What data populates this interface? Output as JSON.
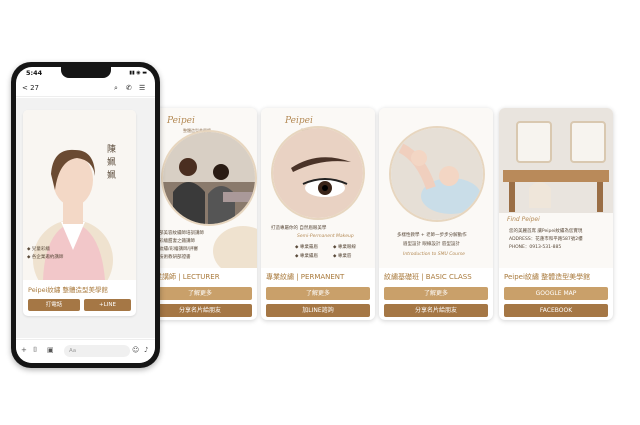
{
  "phone": {
    "time": "5:44",
    "status_icons": "▮▮ ◉ ▬",
    "chat_back": "< 27",
    "chat_icons": [
      "⌕",
      "✆",
      "☰"
    ],
    "profile_name_chars": [
      "陳",
      "姵",
      "姵"
    ],
    "bullets": [
      "兒童彩繪",
      "各企業邀約講師"
    ],
    "card_title": "Peipei紋繡 整體造型美學館",
    "btn_call": "打電話",
    "btn_line": "+LINE",
    "input_placeholder": "Aa",
    "input_icons": [
      "+",
      "⌷",
      "▣",
      "☺",
      "♪"
    ]
  },
  "cards": [
    {
      "brand": "Peipei",
      "brand_sub": "整體造型美學館",
      "captions": [
        "部美容紋繡師培訓講師",
        "彩繪甜妻之鐵講師",
        "紋繡/彩繪講師/評審",
        "技術教研部證書"
      ],
      "title": "專業講師 | LECTURER",
      "buttons": [
        "了解更多",
        "分享名片給朋友"
      ]
    },
    {
      "brand": "Peipei",
      "brand_sub": "整體造型美學館",
      "tagline": "打造專屬你的 自然眉眼美學",
      "script": "Semi-Permanent Makeup",
      "checks": [
        "專業霧眉",
        "專業眼線",
        "專業繡眉",
        "專業唇"
      ],
      "title": "專業紋繡 | PERMANENT",
      "buttons": [
        "了解更多",
        "加LINE諮詢"
      ]
    },
    {
      "captions": [
        "多樣性教學 + 老師一步步分解動作",
        "眉型設計 眼線設計 唇型設計"
      ],
      "script": "Introduction to SMU Course",
      "title": "紋繡基礎班 | BASIC CLASS",
      "buttons": [
        "了解更多",
        "分享名片給朋友"
      ]
    },
    {
      "script": "Find Peipei",
      "captions": [
        "您的美麗首席 讓Peipei紋繡為您實現",
        "ADDRESS：花蓮市和平路587號2樓",
        "PHONE：0913-531-885"
      ],
      "title": "Peipei紋繡 整體造型美學館",
      "buttons": [
        "GOOGLE MAP",
        "FACEBOOK"
      ]
    }
  ],
  "colors": {
    "accent": "#a97a3c",
    "btn_light": "#c9a06a",
    "btn_dark": "#a57745",
    "phone_frame": "#151515"
  }
}
